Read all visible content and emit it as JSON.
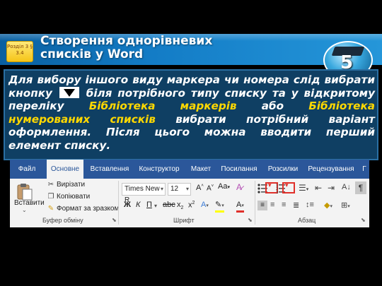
{
  "slide": {
    "section_tag": "Розділ 3 § 3.4",
    "title_line1": "Створення однорівневих",
    "title_line2": "списків у Word",
    "badge_number": "5"
  },
  "text": {
    "part1": "Для вибору іншого виду маркера чи номера слід вибрати кнопку",
    "part2": "біля потрібного типу списку та у відкритому переліку",
    "highlight1": "Бібліотека маркерів",
    "part3": "або",
    "highlight2": "Бібліотека нумерованих списків",
    "part4": "вибрати потрібний варіант оформлення. Після цього можна вводити перший елемент списку."
  },
  "ribbon": {
    "tabs": [
      "Файл",
      "Основне",
      "Вставлення",
      "Конструктор",
      "Макет",
      "Посилання",
      "Розсилки",
      "Рецензування",
      "Г"
    ],
    "active_tab": "Основне",
    "clipboard": {
      "paste": "Вставити",
      "cut": "Вирізати",
      "copy": "Копіювати",
      "format_painter": "Формат за зразком",
      "group": "Буфер обміну"
    },
    "font": {
      "font_name": "Times New R",
      "font_size": "12",
      "bold": "Ж",
      "italic": "К",
      "underline": "П",
      "group": "Шрифт"
    },
    "paragraph": {
      "group": "Абзац"
    }
  },
  "colors": {
    "header": "#137cc6",
    "textbox": "#0f3f63",
    "highlight_text": "#ffd800",
    "ribbon_tabbar": "#2b579a",
    "highlight_border": "#e0302a"
  }
}
